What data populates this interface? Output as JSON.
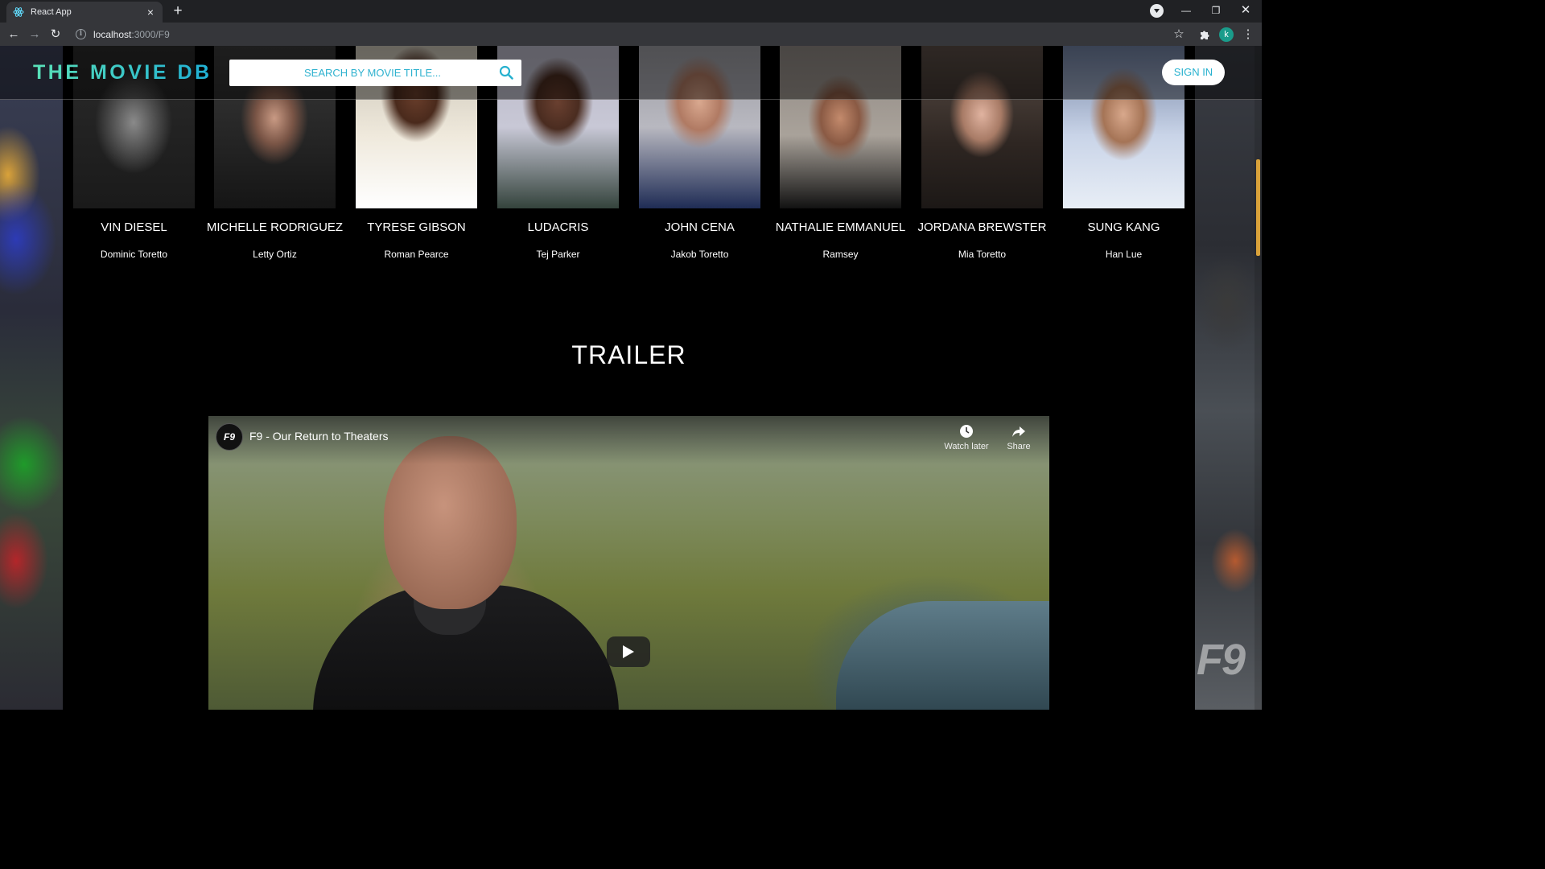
{
  "browser": {
    "tab_title": "React App",
    "url_host": "localhost",
    "url_path": ":3000/F9",
    "profile_initial": "k"
  },
  "header": {
    "logo": "THE MOVIE DB",
    "search_placeholder": "SEARCH BY MOVIE TITLE...",
    "signin_label": "SIGN IN"
  },
  "cast": [
    {
      "name": "VIN DIESEL",
      "character": "Dominic Toretto"
    },
    {
      "name": "MICHELLE RODRIGUEZ",
      "character": "Letty Ortiz"
    },
    {
      "name": "TYRESE GIBSON",
      "character": "Roman Pearce"
    },
    {
      "name": "LUDACRIS",
      "character": "Tej Parker"
    },
    {
      "name": "JOHN CENA",
      "character": "Jakob Toretto"
    },
    {
      "name": "NATHALIE EMMANUEL",
      "character": "Ramsey"
    },
    {
      "name": "JORDANA BREWSTER",
      "character": "Mia Toretto"
    },
    {
      "name": "SUNG KANG",
      "character": "Han Lue"
    }
  ],
  "trailer": {
    "heading": "TRAILER",
    "video_title": "F9 - Our Return to Theaters",
    "channel_badge": "F9",
    "watch_later_label": "Watch later",
    "share_label": "Share"
  },
  "background_right_logo": "F9",
  "colors": {
    "accent": "#27b1cf",
    "logo_gradient_start": "#5ae1b8",
    "logo_gradient_end": "#1fb0d6"
  }
}
